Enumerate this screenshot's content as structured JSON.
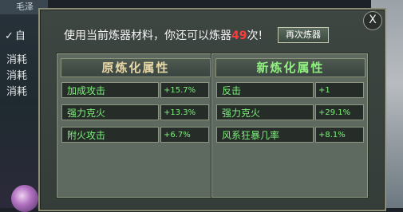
{
  "background": {
    "left_label": "毛泽",
    "left_lines": [
      "消耗",
      "消耗",
      "消耗"
    ]
  },
  "dialog": {
    "notice_prefix": "使用当前炼器材料，你还可以炼器",
    "remaining_count": "49",
    "notice_suffix": "次!",
    "refine_button": "再次炼器",
    "close_label": "X"
  },
  "original": {
    "title": "原炼化属性",
    "attributes": [
      {
        "name": "加成攻击",
        "value": "+15.7%"
      },
      {
        "name": "强力克火",
        "value": "+13.3%"
      },
      {
        "name": "附火攻击",
        "value": "+6.7%"
      }
    ]
  },
  "new": {
    "title": "新炼化属性",
    "attributes": [
      {
        "name": "反击",
        "value": "+1"
      },
      {
        "name": "强力克火",
        "value": "+29.1%"
      },
      {
        "name": "风系狂暴几率",
        "value": "+8.1%"
      }
    ]
  },
  "colors": {
    "attribute_text": "#7cf07a",
    "remaining_count": "#ff3c3c",
    "new_title": "#90f080",
    "original_title": "#e8d8a8"
  }
}
